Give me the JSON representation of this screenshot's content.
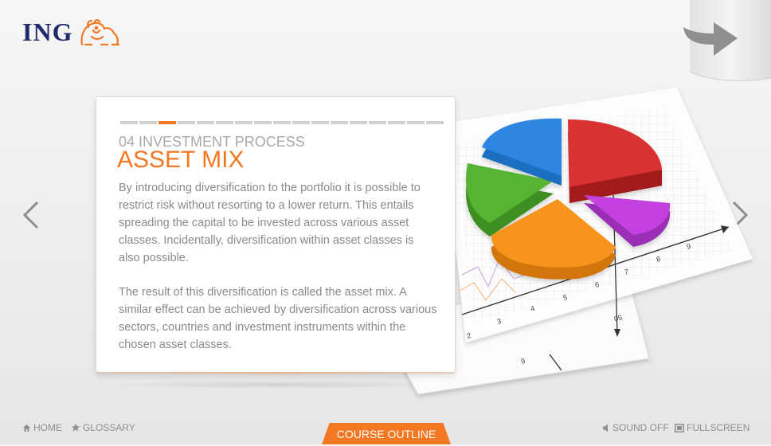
{
  "brand": {
    "name": "ING",
    "color": "#1f2a6b",
    "lion_color": "#f47721"
  },
  "progress": {
    "total": 17,
    "current": 3,
    "active_color": "#f47721"
  },
  "slide": {
    "section": "04 INVESTMENT PROCESS",
    "title": "ASSET MIX",
    "paragraphs": [
      "By introducing diversification to the portfolio it is possible to restrict risk without resorting to a lower return. This entails spreading the capital to be invested across various asset classes. Incidentally, diversification within asset classes is also possible.",
      "The result of this diversification is called the asset mix. A similar effect can be achieved by diversification across various sectors, countries and investment instruments within the chosen asset classes."
    ]
  },
  "illustration": {
    "icon": "pie-chart-on-graph-paper-icon",
    "slice_colors": [
      "#d32f2f",
      "#c23bdb",
      "#f7941d",
      "#4caf2f",
      "#2f86e0"
    ],
    "axis_numbers": [
      "2",
      "3",
      "4",
      "5",
      "6",
      "7",
      "8",
      "9",
      "9",
      "50"
    ]
  },
  "navigation": {
    "prev_icon": "chevron-left-icon",
    "next_icon": "chevron-right-icon",
    "exit_icon": "exit-arrow-icon"
  },
  "footer": {
    "home": "HOME",
    "glossary": "GLOSSARY",
    "course_outline": "COURSE OUTLINE",
    "sound": "SOUND OFF",
    "fullscreen": "FULLSCREEN"
  },
  "colors": {
    "accent": "#f47721",
    "text_muted": "#8a8a8a",
    "footer_text": "#8e8e8e"
  }
}
